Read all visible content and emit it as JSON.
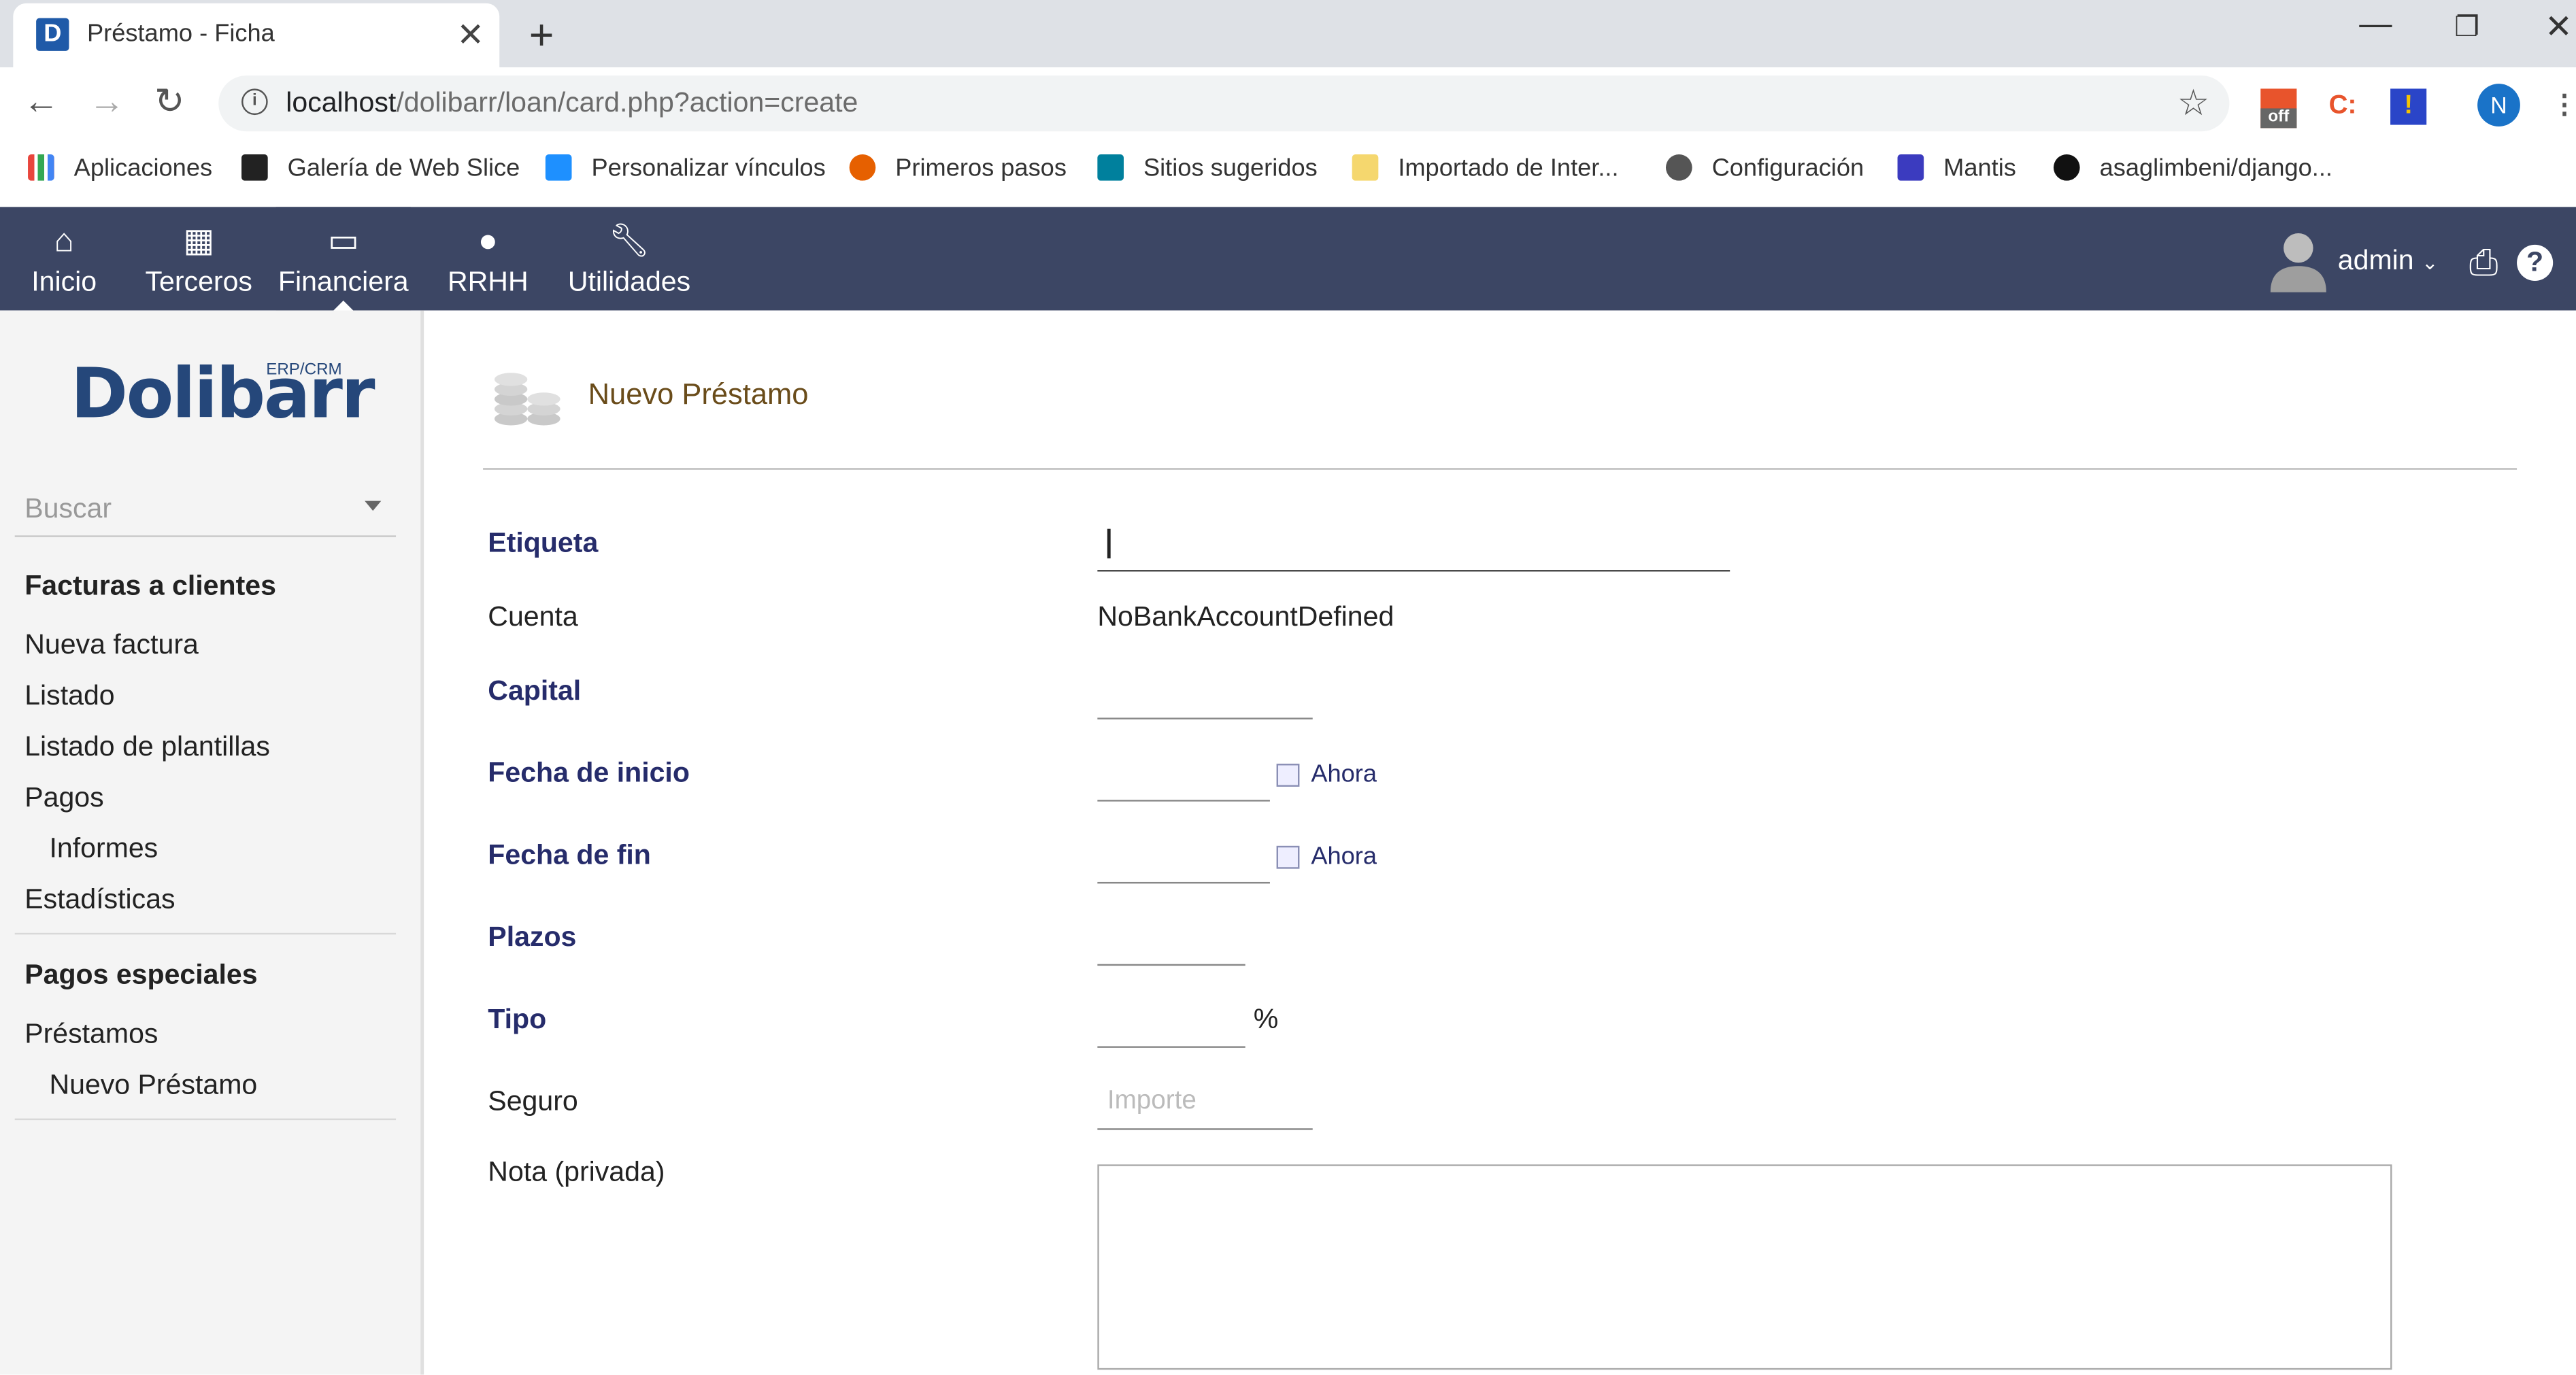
{
  "browser": {
    "tab_title": "Préstamo - Ficha",
    "favicon_letter": "D",
    "url_host": "localhost",
    "url_path": "/dolibarr/loan/card.php?action=create",
    "profile_initial": "N",
    "extension_badge": "off",
    "bookmarks": [
      {
        "label": "Aplicaciones",
        "color": "#e8453c"
      },
      {
        "label": "Galería de Web Slice",
        "color": "#222222"
      },
      {
        "label": "Personalizar vínculos",
        "color": "#1e90ff"
      },
      {
        "label": "Primeros pasos",
        "color": "#e66000"
      },
      {
        "label": "Sitios sugeridos",
        "color": "#00809d"
      },
      {
        "label": "Importado de Inter...",
        "color": "#f5d76e"
      },
      {
        "label": "Configuración",
        "color": "#555555"
      },
      {
        "label": "Mantis",
        "color": "#3b3bbf"
      },
      {
        "label": "asaglimbeni/django...",
        "color": "#111111"
      }
    ]
  },
  "topbar": {
    "background": "#3c4664",
    "menus": [
      {
        "label": "Inicio",
        "icon": "home-icon"
      },
      {
        "label": "Terceros",
        "icon": "building-icon"
      },
      {
        "label": "Financiera",
        "icon": "money-icon"
      },
      {
        "label": "RRHH",
        "icon": "user-icon"
      },
      {
        "label": "Utilidades",
        "icon": "wrench-icon"
      }
    ],
    "user": "admin"
  },
  "sidebar": {
    "logo": "Dolibarr",
    "logo_sub": "ERP/CRM",
    "search_placeholder": "Buscar",
    "sections": [
      {
        "title": "Facturas a clientes",
        "items": [
          "Nueva factura",
          "Listado",
          "Listado de plantillas",
          "Pagos",
          "Informes",
          "Estadísticas"
        ]
      },
      {
        "title": "Pagos especiales",
        "items": [
          "Préstamos",
          "Nuevo Préstamo"
        ]
      }
    ]
  },
  "main": {
    "title": "Nuevo Préstamo",
    "fields": {
      "etiqueta": "Etiqueta",
      "cuenta": "Cuenta",
      "cuenta_value": "NoBankAccountDefined",
      "capital": "Capital",
      "fecha_inicio": "Fecha de inicio",
      "fecha_fin": "Fecha de fin",
      "plazos": "Plazos",
      "tipo": "Tipo",
      "tipo_unit": "%",
      "seguro": "Seguro",
      "seguro_placeholder": "Importe",
      "nota": "Nota (privada)"
    },
    "now_link": "Ahora"
  }
}
